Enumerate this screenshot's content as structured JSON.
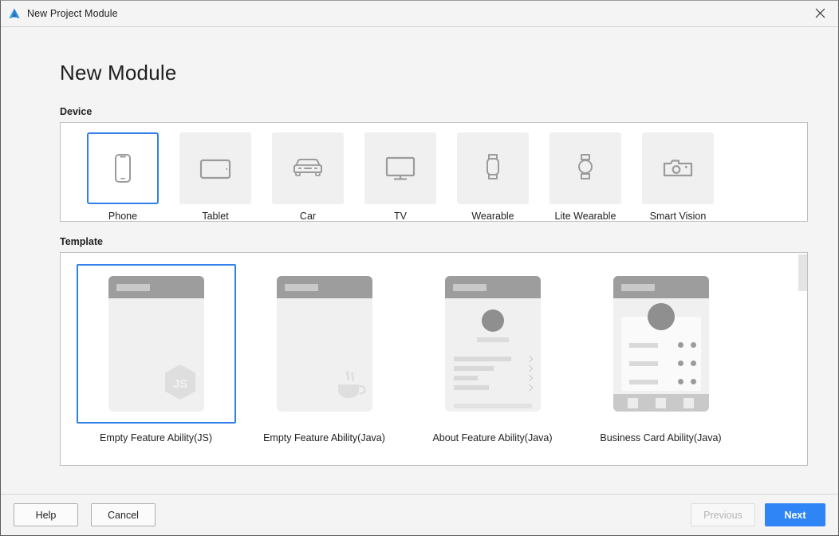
{
  "titlebar": {
    "title": "New Project Module",
    "app_icon": "deveco-logo-icon",
    "close_icon": "close-icon"
  },
  "page": {
    "title": "New Module"
  },
  "device_section": {
    "label": "Device",
    "items": [
      {
        "label": "Phone",
        "icon": "phone-icon",
        "selected": true
      },
      {
        "label": "Tablet",
        "icon": "tablet-icon",
        "selected": false
      },
      {
        "label": "Car",
        "icon": "car-icon",
        "selected": false
      },
      {
        "label": "TV",
        "icon": "tv-icon",
        "selected": false
      },
      {
        "label": "Wearable",
        "icon": "wearable-icon",
        "selected": false
      },
      {
        "label": "Lite Wearable",
        "icon": "lite-wearable-icon",
        "selected": false
      },
      {
        "label": "Smart Vision",
        "icon": "camera-icon",
        "selected": false
      }
    ]
  },
  "template_section": {
    "label": "Template",
    "items": [
      {
        "label": "Empty Feature Ability(JS)",
        "mock": "js",
        "selected": true
      },
      {
        "label": "Empty Feature Ability(Java)",
        "mock": "java",
        "selected": false
      },
      {
        "label": "About Feature Ability(Java)",
        "mock": "about",
        "selected": false
      },
      {
        "label": "Business Card Ability(Java)",
        "mock": "business",
        "selected": false
      }
    ]
  },
  "footer": {
    "help": "Help",
    "cancel": "Cancel",
    "previous": "Previous",
    "next": "Next"
  },
  "colors": {
    "accent": "#2f7fed",
    "primary_button": "#2f85f5",
    "panel_background": "#ffffff",
    "dialog_background": "#f4f4f4",
    "tile_background": "#f0f0f0",
    "mock_header": "#9d9d9d",
    "disabled_text": "#b4b4b4"
  }
}
